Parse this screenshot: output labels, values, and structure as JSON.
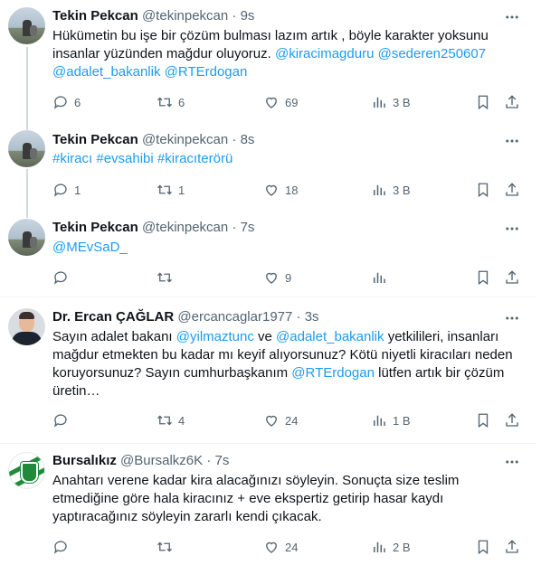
{
  "tweets": [
    {
      "name": "Tekin Pekcan",
      "handle": "@tekinpekcan",
      "time": "9s",
      "text1": "Hükümetin bu işe bir çözüm bulması lazım artık , böyle karakter yoksunu insanlar yüzünden mağdur oluyoruz. ",
      "mentions1": [
        "@kiracimagduru",
        "@sederen250607",
        "@adalet_bakanlik",
        "@RTErdogan"
      ],
      "replies": "6",
      "retweets": "6",
      "likes": "69",
      "views": "3 B"
    },
    {
      "name": "Tekin Pekcan",
      "handle": "@tekinpekcan",
      "time": "8s",
      "hashtags": [
        "#kiracı",
        "#evsahibi",
        "#kiracıterörü"
      ],
      "replies": "1",
      "retweets": "1",
      "likes": "18",
      "views": "3 B"
    },
    {
      "name": "Tekin Pekcan",
      "handle": "@tekinpekcan",
      "time": "7s",
      "mention": "@MEvSaD_",
      "replies": "",
      "retweets": "",
      "likes": "9",
      "views": ""
    },
    {
      "name": "Dr. Ercan ÇAĞLAR",
      "handle": "@ercancaglar1977",
      "time": "3s",
      "t1": "Sayın adalet bakanı ",
      "m1": "@yilmaztunc",
      "t2": " ve ",
      "m2": "@adalet_bakanlik",
      "t3": " yetkilileri, insanları mağdur etmekten bu kadar mı keyif alıyorsunuz? Kötü niyetli kiracıları neden koruyorsunuz? Sayın cumhurbaşkanım ",
      "m3": "@RTErdogan",
      "t4": " lütfen artık bir çözüm üretin…",
      "replies": "",
      "retweets": "4",
      "likes": "24",
      "views": "1 B"
    },
    {
      "name": "Bursalıkız",
      "handle": "@Bursalkz6K",
      "time": "7s",
      "text": "Anahtarı verene kadar kira alacağınızı söyleyin. Sonuçta size teslim etmediğine göre hala kiracınız + eve ekspertiz getirip hasar kaydı yaptıracağınız söyleyin zararlı kendi çıkacak.",
      "replies": "",
      "retweets": "",
      "likes": "24",
      "views": "2 B"
    }
  ],
  "separator": "·",
  "colors": {
    "link": "#1d9bf0",
    "muted": "#536471",
    "text": "#0f1419",
    "thread_line": "#cfd9de"
  },
  "icons": [
    "reply-icon",
    "retweet-icon",
    "like-icon",
    "views-icon",
    "bookmark-icon",
    "share-icon",
    "more-icon"
  ]
}
